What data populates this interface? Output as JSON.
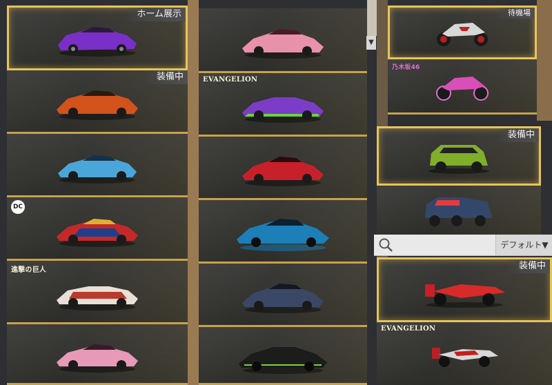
{
  "tags": {
    "home_display": "ホーム展示",
    "equipped": "装備中",
    "waiting_area": "待機場"
  },
  "collabs": {
    "evangelion": "EVANGELION",
    "attack_on_titan": "進撃の巨人",
    "nogizaka": "乃木坂46",
    "dc": "DC"
  },
  "search": {
    "sort_label": "デフォルト▼"
  },
  "colors": {
    "gold_accent": "#e7c45a",
    "card_bg": "#363633"
  },
  "columns": [
    {
      "items": [
        {
          "vehicle": "purple supercar",
          "tag": "ホーム展示",
          "selected": true
        },
        {
          "vehicle": "orange supercar",
          "tag": "装備中"
        },
        {
          "vehicle": "blue supercar"
        },
        {
          "vehicle": "dc red-blue supercar",
          "collab": "DC"
        },
        {
          "vehicle": "white-red convertible",
          "collab": "進撃の巨人"
        },
        {
          "vehicle": "pink supercar"
        }
      ]
    },
    {
      "items": [
        {
          "vehicle": "pink hypercar"
        },
        {
          "vehicle": "purple-green race car",
          "collab": "EVANGELION"
        },
        {
          "vehicle": "red hypercar"
        },
        {
          "vehicle": "cyan neon hypercar"
        },
        {
          "vehicle": "dark blue hypercar"
        },
        {
          "vehicle": "black-green hypercar"
        }
      ]
    },
    {
      "items": [
        {
          "vehicle": "shark motorcycle",
          "tag": "待機場",
          "selected": true
        },
        {
          "vehicle": "pink motorcycle",
          "collab": "乃木坂46"
        }
      ]
    },
    {
      "items": [
        {
          "vehicle": "green suv",
          "tag": "装備中",
          "selected": true
        },
        {
          "vehicle": "blue 6x6 truck"
        },
        {
          "vehicle": "red formula car",
          "tag": "装備中",
          "selected": true
        },
        {
          "vehicle": "red-white formula car",
          "collab": "EVANGELION"
        }
      ]
    }
  ]
}
